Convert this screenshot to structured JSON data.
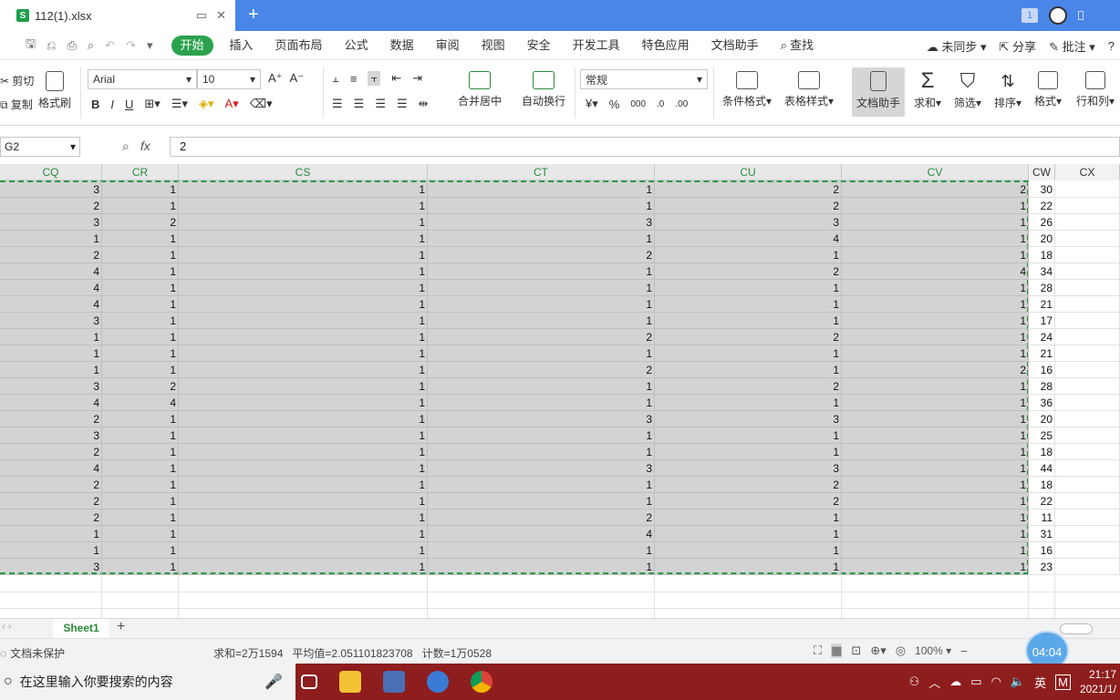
{
  "window": {
    "tab_title": "112(1).xlsx",
    "file_badge": "S",
    "new_tab": "+",
    "right_badge": "1"
  },
  "menu": {
    "items": [
      "开始",
      "插入",
      "页面布局",
      "公式",
      "数据",
      "审阅",
      "视图",
      "安全",
      "开发工具",
      "特色应用",
      "文档助手"
    ],
    "search": "查找",
    "sync": "未同步",
    "share": "分享",
    "comment": "批注",
    "help": "?"
  },
  "ribbon": {
    "cut": "剪切",
    "copy": "复制",
    "format_painter": "格式刷",
    "font": "Arial",
    "font_size": "10",
    "merge_center": "合并居中",
    "wrap": "自动换行",
    "number_format": "常规",
    "conditional_format": "条件格式",
    "table_style": "表格样式",
    "doc_assistant": "文档助手",
    "sum": "求和",
    "filter": "筛选",
    "sort": "排序",
    "format": "格式",
    "row_col": "行和列",
    "bold": "B",
    "italic": "I",
    "underline": "U",
    "percent": "%",
    "thousands": "000",
    "inc_decimal": ".0",
    "dec_decimal": ".00"
  },
  "formula_bar": {
    "name_box": "G2",
    "fx": "fx",
    "value": "2"
  },
  "columns": [
    "CQ",
    "CR",
    "CS",
    "CT",
    "CU",
    "CV",
    "CW",
    "CX"
  ],
  "rows": [
    [
      "3",
      "1",
      "1",
      "1",
      "2",
      "2",
      "30"
    ],
    [
      "2",
      "1",
      "1",
      "1",
      "2",
      "1",
      "22"
    ],
    [
      "3",
      "2",
      "1",
      "3",
      "3",
      "1",
      "26"
    ],
    [
      "1",
      "1",
      "1",
      "1",
      "4",
      "1",
      "20"
    ],
    [
      "2",
      "1",
      "1",
      "2",
      "1",
      "1",
      "18"
    ],
    [
      "4",
      "1",
      "1",
      "1",
      "2",
      "4",
      "34"
    ],
    [
      "4",
      "1",
      "1",
      "1",
      "1",
      "1",
      "28"
    ],
    [
      "4",
      "1",
      "1",
      "1",
      "1",
      "1",
      "21"
    ],
    [
      "3",
      "1",
      "1",
      "1",
      "1",
      "1",
      "17"
    ],
    [
      "1",
      "1",
      "1",
      "2",
      "2",
      "1",
      "24"
    ],
    [
      "1",
      "1",
      "1",
      "1",
      "1",
      "1",
      "21"
    ],
    [
      "1",
      "1",
      "1",
      "2",
      "1",
      "2",
      "16"
    ],
    [
      "3",
      "2",
      "1",
      "1",
      "2",
      "1",
      "28"
    ],
    [
      "4",
      "4",
      "1",
      "1",
      "1",
      "1",
      "36"
    ],
    [
      "2",
      "1",
      "1",
      "3",
      "3",
      "1",
      "20"
    ],
    [
      "3",
      "1",
      "1",
      "1",
      "1",
      "1",
      "25"
    ],
    [
      "2",
      "1",
      "1",
      "1",
      "1",
      "1",
      "18"
    ],
    [
      "4",
      "1",
      "1",
      "3",
      "3",
      "1",
      "44"
    ],
    [
      "2",
      "1",
      "1",
      "1",
      "2",
      "1",
      "18"
    ],
    [
      "2",
      "1",
      "1",
      "1",
      "2",
      "1",
      "22"
    ],
    [
      "2",
      "1",
      "1",
      "2",
      "1",
      "1",
      "11"
    ],
    [
      "1",
      "1",
      "1",
      "4",
      "1",
      "1",
      "31"
    ],
    [
      "1",
      "1",
      "1",
      "1",
      "1",
      "1",
      "16"
    ],
    [
      "3",
      "1",
      "1",
      "1",
      "1",
      "1",
      "23"
    ]
  ],
  "sheet": {
    "name": "Sheet1",
    "add": "+"
  },
  "status": {
    "protection": "文档未保护",
    "sum": "求和=2万1594",
    "average": "平均值=2.051101823708",
    "count": "计数=1万0528",
    "zoom": "100%",
    "timer": "04:04"
  },
  "taskbar": {
    "search_placeholder": "在这里输入你要搜索的内容",
    "ime": "英",
    "ime2": "M",
    "time": "21:17",
    "date": "2021/1/"
  }
}
